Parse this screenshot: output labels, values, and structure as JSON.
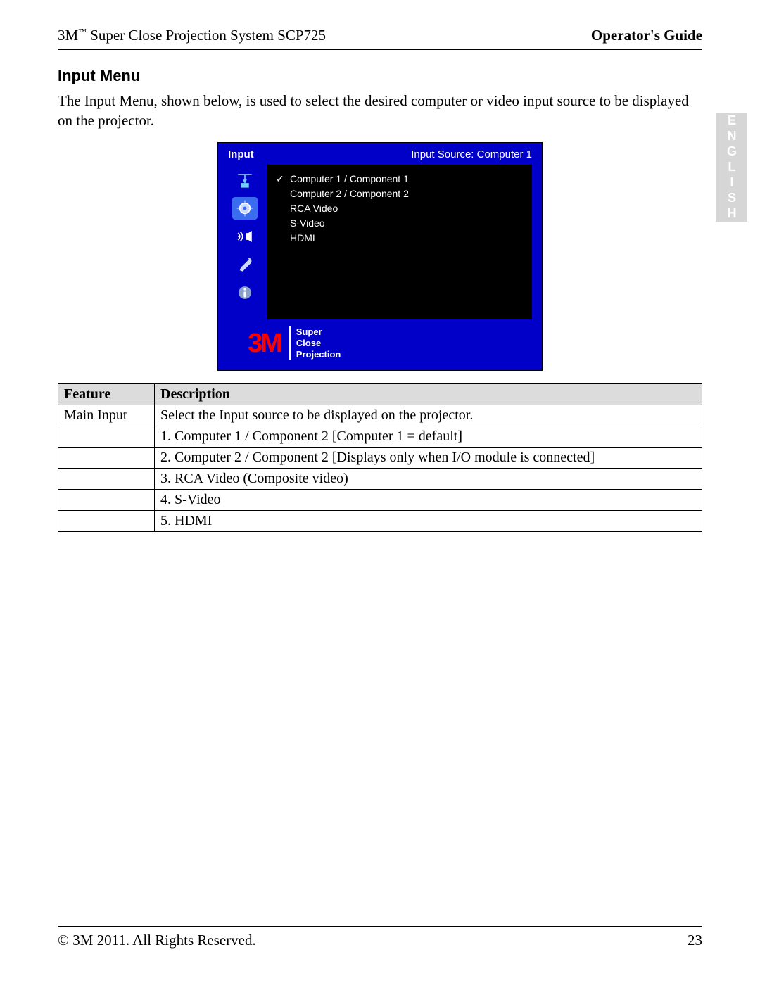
{
  "header": {
    "product_line_prefix": "3M",
    "tm": "™",
    "product_line_suffix": " Super Close Projection System SCP725",
    "right": "Operator's Guide"
  },
  "language_tab": "ENGLISH",
  "section": {
    "title": "Input Menu",
    "description": "The Input Menu, shown below, is used to select the desired computer or video input source to be displayed on the projector."
  },
  "osd": {
    "title": "Input",
    "status": "Input Source: Computer 1",
    "items": [
      {
        "checked": true,
        "label": "Computer 1 / Component 1"
      },
      {
        "checked": false,
        "label": "Computer 2 / Component 2"
      },
      {
        "checked": false,
        "label": "RCA Video"
      },
      {
        "checked": false,
        "label": "S-Video"
      },
      {
        "checked": false,
        "label": "HDMI"
      }
    ],
    "icons": [
      {
        "name": "input-icon",
        "selected": false
      },
      {
        "name": "image-icon",
        "selected": true
      },
      {
        "name": "audio-icon",
        "selected": false
      },
      {
        "name": "settings-icon",
        "selected": false
      },
      {
        "name": "info-icon",
        "selected": false
      }
    ],
    "logo": {
      "brand": "3M",
      "sub1": "Super",
      "sub2": "Close",
      "sub3": "Projection"
    }
  },
  "table": {
    "head_feature": "Feature",
    "head_description": "Description",
    "rows": [
      {
        "feature": "Main Input",
        "description": "Select the Input source to be displayed on the projector."
      },
      {
        "feature": "",
        "description": "1. Computer 1 / Component 2    [Computer 1 = default]"
      },
      {
        "feature": "",
        "description": "2. Computer 2 / Component 2    [Displays only when I/O module is connected]"
      },
      {
        "feature": "",
        "description": "3. RCA Video (Composite video)"
      },
      {
        "feature": "",
        "description": "4. S-Video"
      },
      {
        "feature": "",
        "description": "5. HDMI"
      }
    ]
  },
  "footer": {
    "copyright": "© 3M 2011. All Rights Reserved.",
    "page_number": "23"
  }
}
